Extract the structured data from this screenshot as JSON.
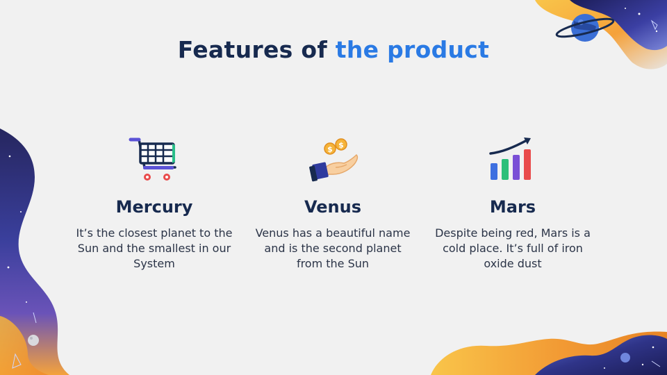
{
  "title": {
    "part1": "Features of ",
    "part2": "the product"
  },
  "features": [
    {
      "icon": "shopping-cart-icon",
      "heading": "Mercury",
      "text": "It’s the closest planet to the Sun and the smallest in our System"
    },
    {
      "icon": "hand-with-coins-icon",
      "heading": "Venus",
      "text": "Venus has a beautiful name and is the second planet from the Sun"
    },
    {
      "icon": "growth-chart-icon",
      "heading": "Mars",
      "text": "Despite being red, Mars is a cold place. It’s full of iron oxide dust"
    }
  ],
  "colors": {
    "title": "#172a4f",
    "accent": "#2a7ae4",
    "body_text": "#2b3447",
    "background": "#f1f1f1"
  }
}
